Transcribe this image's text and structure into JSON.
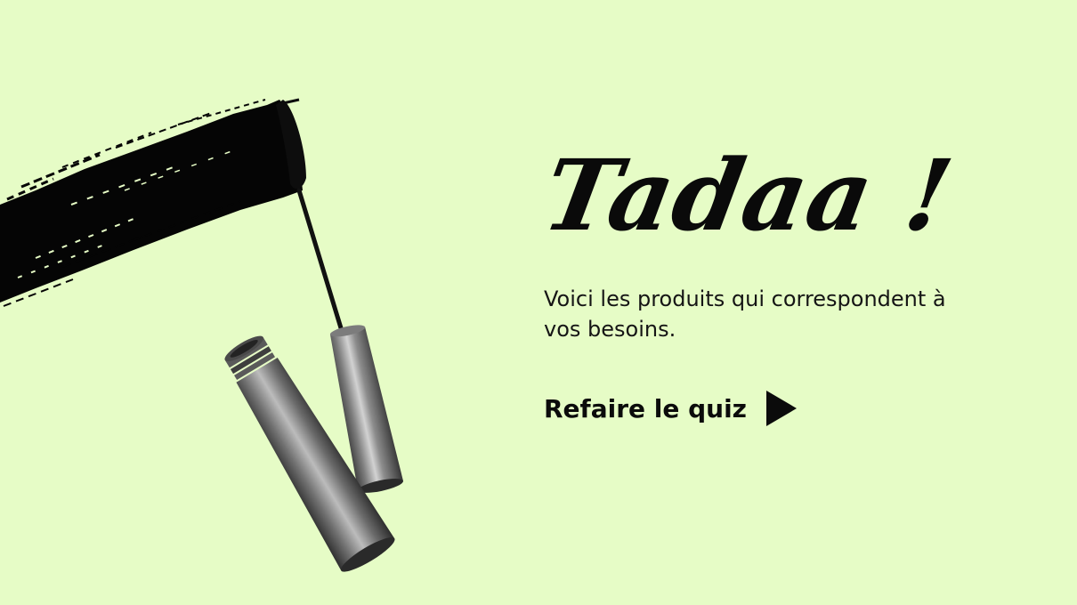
{
  "colors": {
    "background": "#e6fcc6",
    "text": "#0b0b0b",
    "mascara_ink": "#050505",
    "tube_metal": "#8b8b8b"
  },
  "hero": {
    "title": "Tadaa !",
    "subtitle": "Voici les produits qui correspondent à vos besoins.",
    "cta_label": "Refaire le quiz",
    "cta_icon": "play-triangle-icon"
  },
  "illustration": {
    "name": "mascara-illustration"
  }
}
